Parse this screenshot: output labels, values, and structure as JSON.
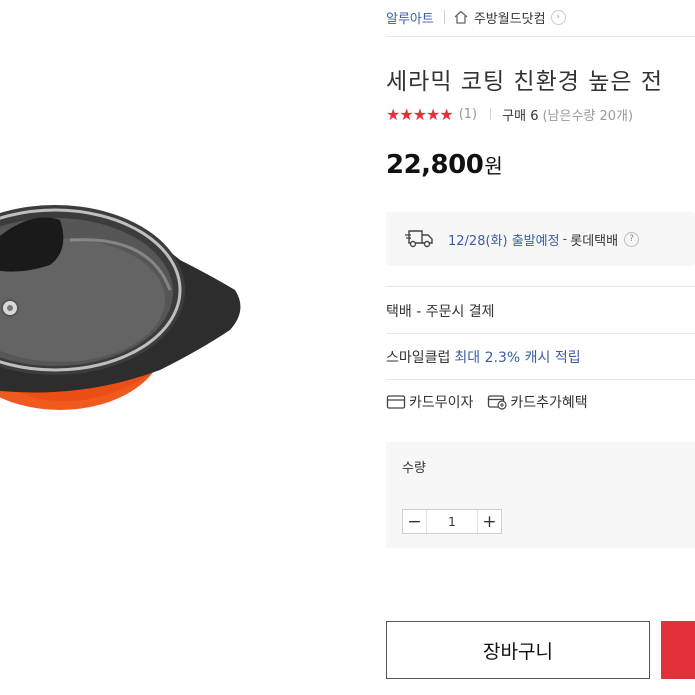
{
  "breadcrumb": {
    "brand": "알루아트",
    "store": "주방월드닷컴",
    "store_arrow": "›"
  },
  "product": {
    "title": "세라믹 코팅 친환경 높은 전"
  },
  "rating": {
    "stars": "★★★★★",
    "review_count": "(1)",
    "purchase": "구매 6",
    "remaining": "(남은수량 20개)"
  },
  "price": {
    "amount": "22,800",
    "unit": "원"
  },
  "shipping": {
    "date": "12/28(화) 출발예정",
    "dash": "-",
    "carrier": "롯데택배",
    "help": "?"
  },
  "payment": {
    "text": "택배 - 주문시 결제"
  },
  "smile_club": {
    "label": "스마일클럽",
    "value": "최대 2.3% 캐시 적립"
  },
  "cards": {
    "no_interest": "카드무이자",
    "extra_benefit": "카드추가혜택"
  },
  "quantity": {
    "label": "수량",
    "minus": "−",
    "value": "1",
    "plus": "+"
  },
  "actions": {
    "cart": "장바구니"
  },
  "colors": {
    "brand_blue": "#3a5fa5",
    "accent_red": "#e3313b",
    "pan_orange": "#f05a1e"
  },
  "icons": [
    "home-icon",
    "chevron-right-icon",
    "truck-icon",
    "help-icon",
    "card-icon",
    "card-plus-icon",
    "minus-icon",
    "plus-icon"
  ]
}
